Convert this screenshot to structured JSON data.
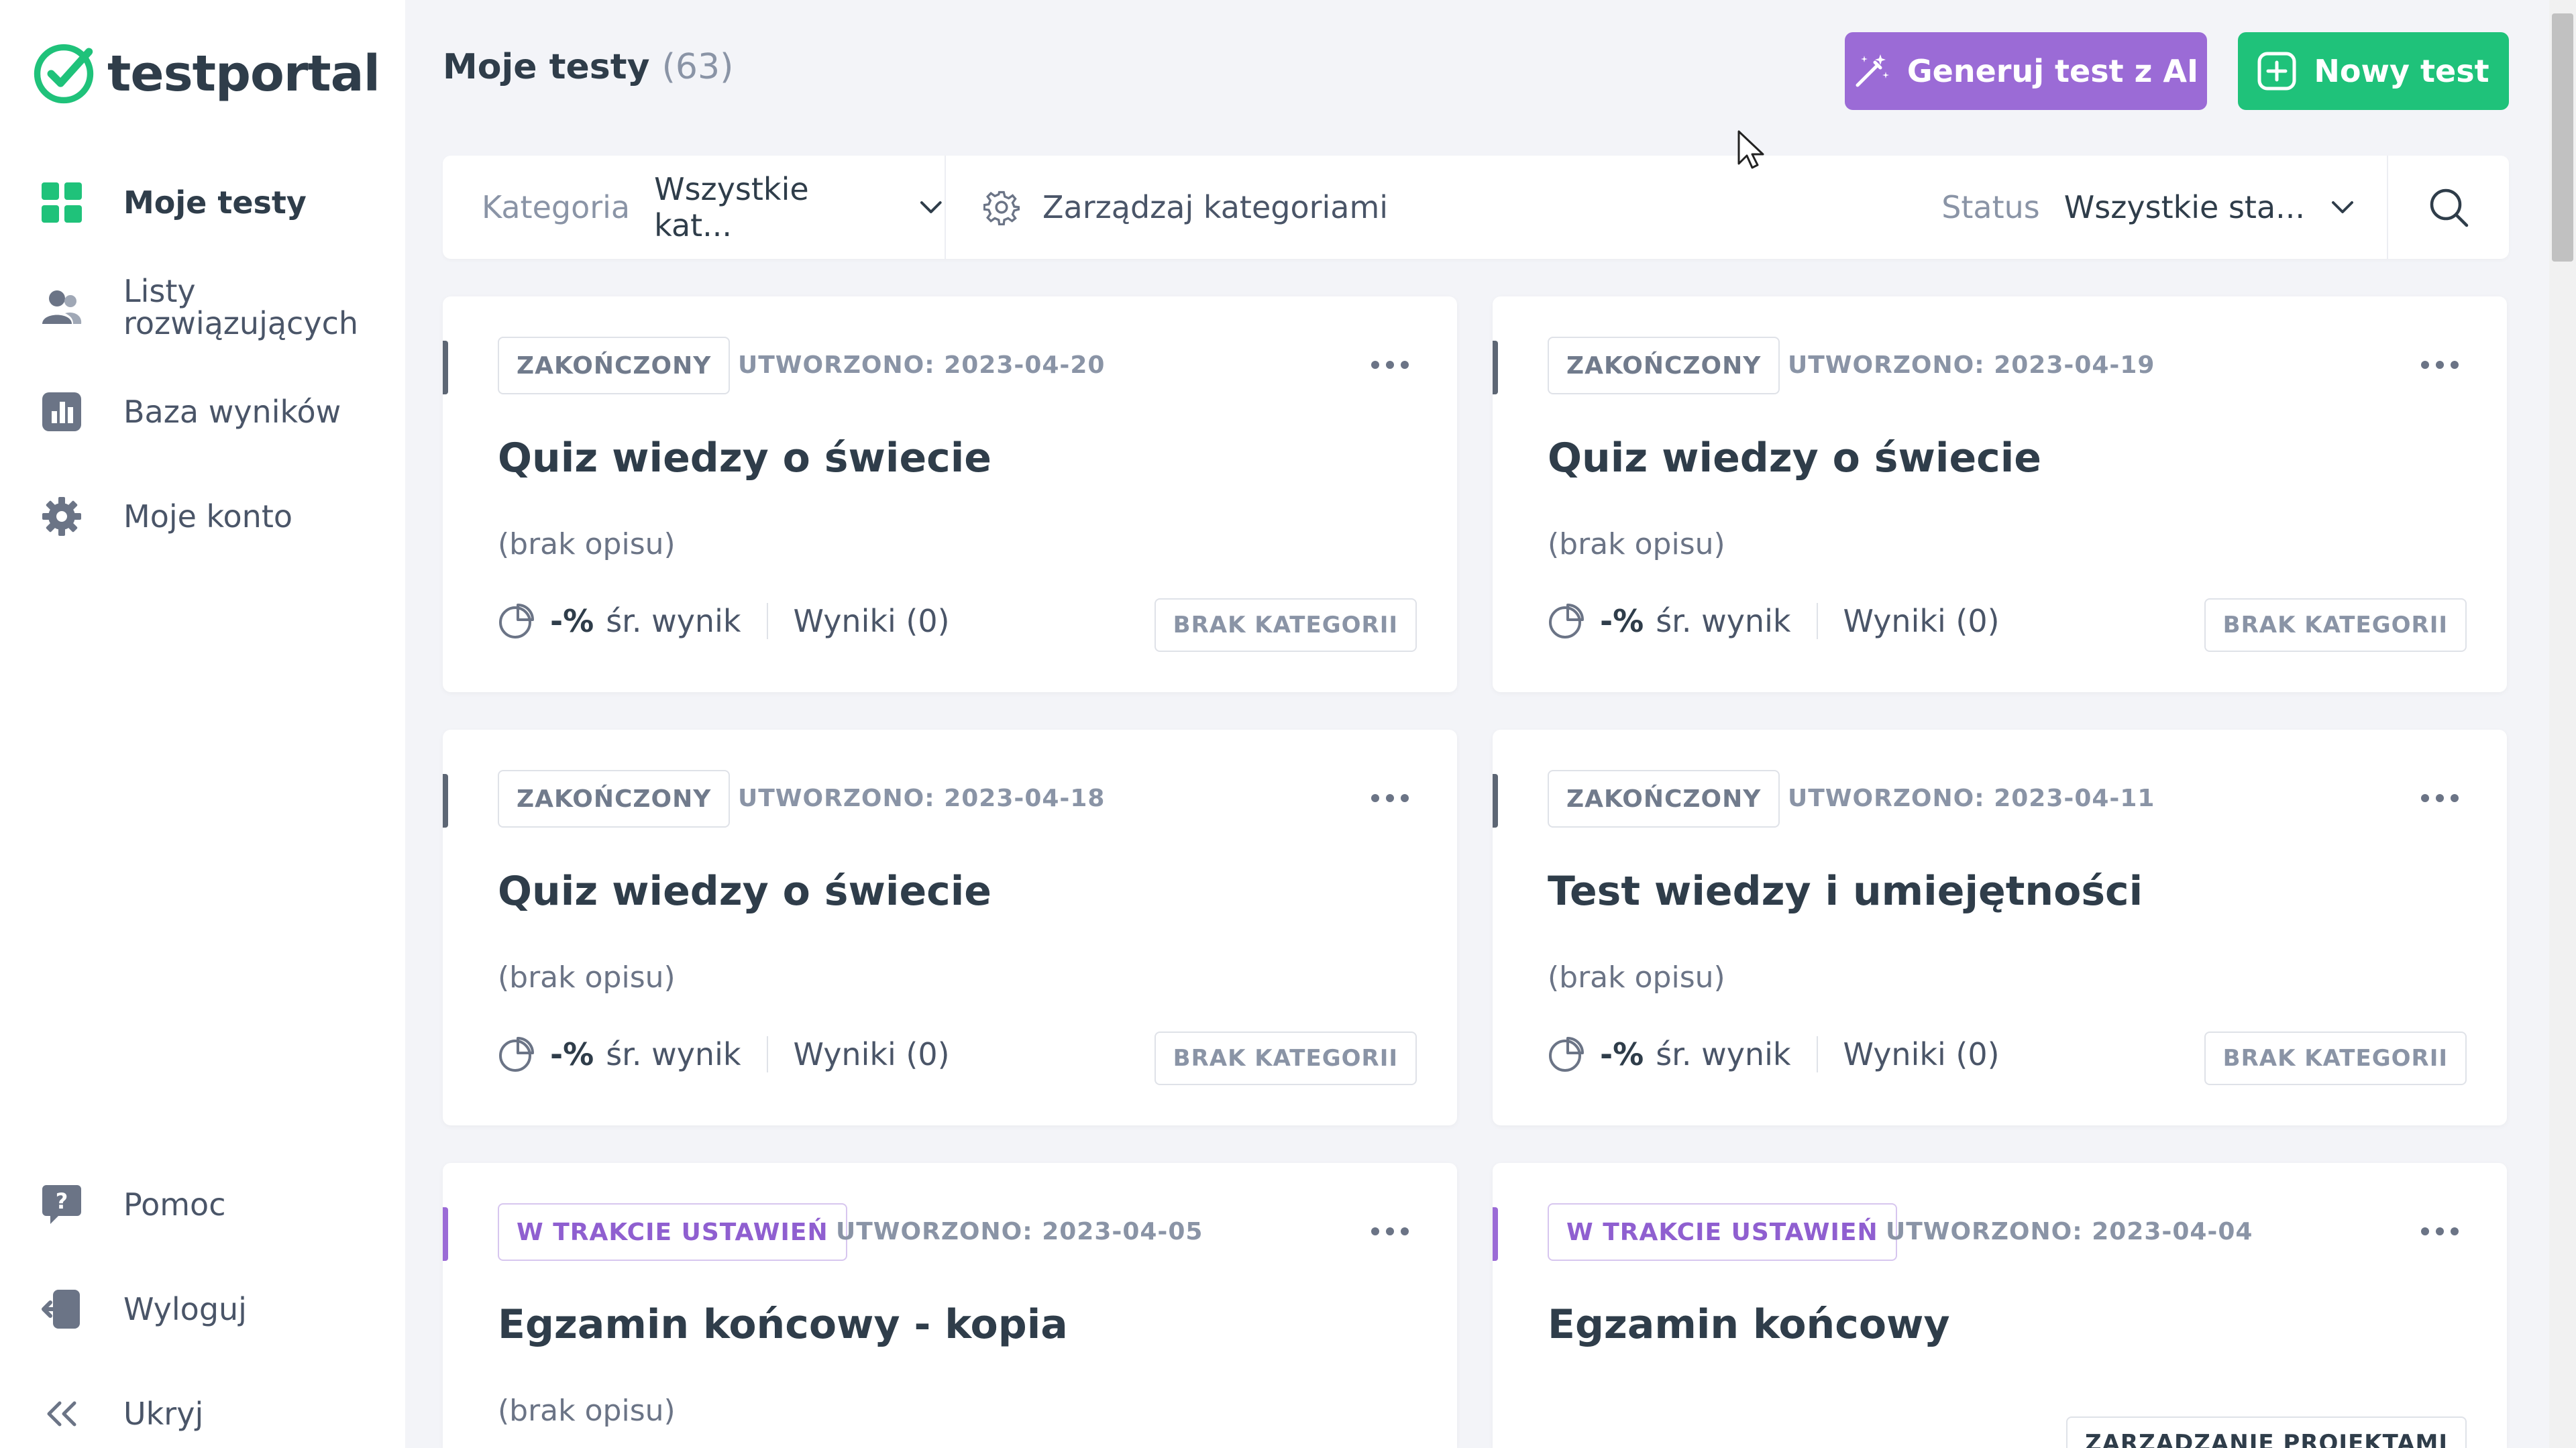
{
  "brand": {
    "name": "testportal",
    "accent_color": "#1fc27a"
  },
  "sidebar": {
    "items": [
      {
        "label": "Moje testy",
        "icon": "grid-icon"
      },
      {
        "label": "Listy rozwiązujących",
        "icon": "users-icon"
      },
      {
        "label": "Baza wyników",
        "icon": "bar-chart-icon"
      },
      {
        "label": "Moje konto",
        "icon": "gear-icon"
      }
    ],
    "bottom_items": [
      {
        "label": "Pomoc",
        "icon": "help-icon"
      },
      {
        "label": "Wyloguj",
        "icon": "logout-icon"
      },
      {
        "label": "Ukryj",
        "icon": "double-chevron-left-icon"
      }
    ]
  },
  "header": {
    "title": "Moje testy",
    "count": "(63)",
    "ai_button": "Generuj test z AI",
    "new_button": "Nowy test"
  },
  "filters": {
    "category_label": "Kategoria",
    "category_value": "Wszystkie kat...",
    "manage_label": "Zarządzaj kategoriami",
    "status_label": "Status",
    "status_value": "Wszystkie sta..."
  },
  "cards": [
    {
      "status": "ZAKOŃCZONY",
      "created": "UTWORZONO: 2023-04-20",
      "title": "Quiz wiedzy o świecie",
      "description": "(brak opisu)",
      "avg": "-%",
      "avg_label": "śr. wynik",
      "results": "Wyniki (0)",
      "category": "BRAK KATEGORII"
    },
    {
      "status": "ZAKOŃCZONY",
      "created": "UTWORZONO: 2023-04-19",
      "title": "Quiz wiedzy o świecie",
      "description": "(brak opisu)",
      "avg": "-%",
      "avg_label": "śr. wynik",
      "results": "Wyniki (0)",
      "category": "BRAK KATEGORII"
    },
    {
      "status": "ZAKOŃCZONY",
      "created": "UTWORZONO: 2023-04-18",
      "title": "Quiz wiedzy o świecie",
      "description": "(brak opisu)",
      "avg": "-%",
      "avg_label": "śr. wynik",
      "results": "Wyniki (0)",
      "category": "BRAK KATEGORII"
    },
    {
      "status": "ZAKOŃCZONY",
      "created": "UTWORZONO: 2023-04-11",
      "title": "Test wiedzy i umiejętności",
      "description": "(brak opisu)",
      "avg": "-%",
      "avg_label": "śr. wynik",
      "results": "Wyniki (0)",
      "category": "BRAK KATEGORII"
    },
    {
      "status": "W TRAKCIE USTAWIEŃ",
      "created": "UTWORZONO: 2023-04-05",
      "title": "Egzamin końcowy - kopia",
      "description": "(brak opisu)"
    },
    {
      "status": "W TRAKCIE USTAWIEŃ",
      "created": "UTWORZONO: 2023-04-04",
      "title": "Egzamin końcowy",
      "category": "ZARZĄDZANIE PROJEKTAMI"
    }
  ]
}
